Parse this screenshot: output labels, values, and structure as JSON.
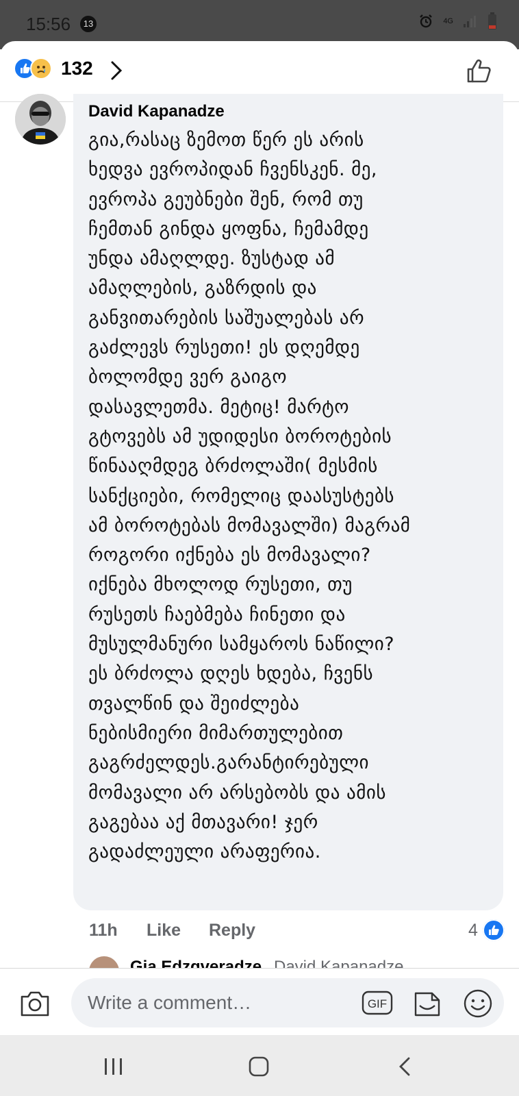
{
  "status_bar": {
    "time": "15:56",
    "notification_count": "13",
    "network": "4G"
  },
  "reactions": {
    "count": "132",
    "icons": [
      "like-reaction-icon",
      "sad-reaction-icon"
    ]
  },
  "comment": {
    "author": "David Kapanadze",
    "lines": [
      "გია,რასაც ზემოთ წერ ეს არის",
      "ხედვა ევროპიდან ჩვენსკენ. მე,",
      "ევროპა გეუბნები შენ, რომ თუ",
      "ჩემთან გინდა ყოფნა, ჩემამდე",
      "უნდა ამაღლდე. ზუსტად ამ",
      "ამაღლების, გაზრდის და",
      "განვითარების საშუალებას არ",
      "გაძლევს რუსეთი! ეს დღემდე",
      "ბოლომდე ვერ გაიგო",
      "დასავლეთმა. მეტიც! მარტო",
      "გტოვებს ამ უდიდესი ბოროტების",
      "წინააღმდეგ ბრძოლაში( მესმის",
      "სანქციები, რომელიც დაასუსტებს",
      "ამ ბოროტებას მომავალში) მაგრამ",
      "როგორი იქნება ეს მომავალი?",
      "იქნება მხოლოდ რუსეთი, თუ",
      "რუსეთს ჩაებმება ჩინეთი და",
      "მუსულმანური სამყაროს ნაწილი?",
      "ეს ბრძოლა დღეს ხდება, ჩვენს",
      "თვალწინ და შეიძლება",
      "ნებისმიერი მიმართულებით",
      "გაგრძელდეს.გარანტირებული",
      "მომავალი არ არსებობს და ამის",
      "გაგებაა აქ მთავარი! ჯერ",
      "გადაძლეული არაფერია."
    ],
    "time": "11h",
    "like_label": "Like",
    "reply_label": "Reply",
    "reaction_count": "4"
  },
  "reply_preview": {
    "name": "Gia Edzgveradze",
    "tag": "David Kapanadze"
  },
  "composer": {
    "placeholder": "Write a comment…",
    "gif_label": "GIF"
  },
  "colors": {
    "facebook_blue": "#1877f2",
    "bubble_bg": "#f0f2f5",
    "meta_gray": "#65676b"
  }
}
